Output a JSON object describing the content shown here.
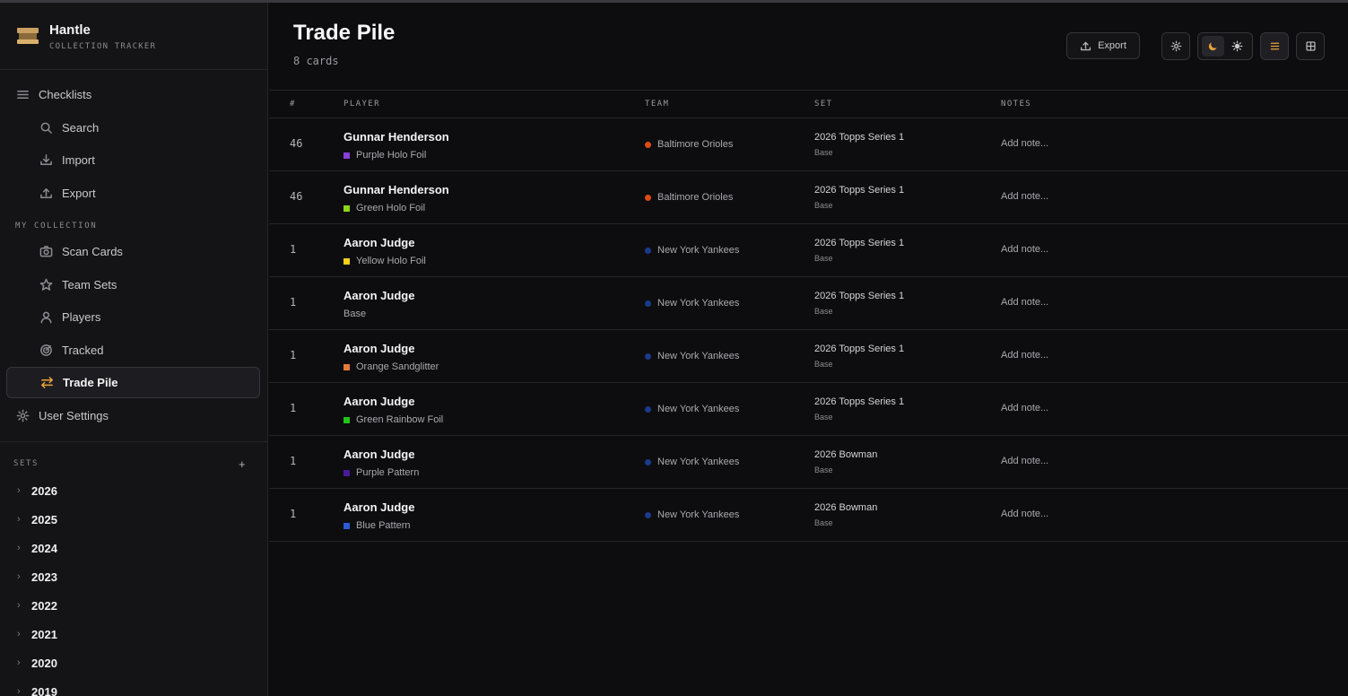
{
  "app": {
    "name": "Hantle",
    "tagline": "COLLECTION TRACKER"
  },
  "sidebar": {
    "nav_top": {
      "label": "Checklists",
      "icon": "list-icon"
    },
    "checklist_items": [
      {
        "label": "Search",
        "icon": "search-icon"
      },
      {
        "label": "Import",
        "icon": "download-icon"
      },
      {
        "label": "Export",
        "icon": "upload-icon"
      }
    ],
    "collection_label": "MY COLLECTION",
    "collection_items": [
      {
        "label": "Scan Cards",
        "icon": "camera-icon"
      },
      {
        "label": "Team Sets",
        "icon": "star-icon"
      },
      {
        "label": "Players",
        "icon": "user-icon"
      },
      {
        "label": "Tracked",
        "icon": "target-icon"
      },
      {
        "label": "Trade Pile",
        "icon": "swap-icon",
        "active": true
      }
    ],
    "settings_item": {
      "label": "User Settings",
      "icon": "gear-icon"
    },
    "sets_label": "SETS",
    "sets_add": "+",
    "years": [
      "2026",
      "2025",
      "2024",
      "2023",
      "2022",
      "2021",
      "2020",
      "2019"
    ]
  },
  "header": {
    "title": "Trade Pile",
    "subtitle": "8 cards",
    "export_label": "Export"
  },
  "table": {
    "columns": [
      "#",
      "PLAYER",
      "TEAM",
      "SET",
      "NOTES"
    ],
    "rows": [
      {
        "num": "46",
        "player": "Gunnar Henderson",
        "variant": "Purple Holo Foil",
        "variant_color": "#8a3fd6",
        "team": "Baltimore Orioles",
        "team_color": "#df4a16",
        "set": "2026 Topps Series 1",
        "set_type": "Base",
        "note": "Add note..."
      },
      {
        "num": "46",
        "player": "Gunnar Henderson",
        "variant": "Green Holo Foil",
        "variant_color": "#8cd61a",
        "team": "Baltimore Orioles",
        "team_color": "#df4a16",
        "set": "2026 Topps Series 1",
        "set_type": "Base",
        "note": "Add note..."
      },
      {
        "num": "1",
        "player": "Aaron Judge",
        "variant": "Yellow Holo Foil",
        "variant_color": "#f2d01c",
        "team": "New York Yankees",
        "team_color": "#1a3a8a",
        "set": "2026 Topps Series 1",
        "set_type": "Base",
        "note": "Add note..."
      },
      {
        "num": "1",
        "player": "Aaron Judge",
        "variant": "Base",
        "variant_color": "",
        "team": "New York Yankees",
        "team_color": "#1a3a8a",
        "set": "2026 Topps Series 1",
        "set_type": "Base",
        "note": "Add note..."
      },
      {
        "num": "1",
        "player": "Aaron Judge",
        "variant": "Orange Sandglitter",
        "variant_color": "#e87a3a",
        "team": "New York Yankees",
        "team_color": "#1a3a8a",
        "set": "2026 Topps Series 1",
        "set_type": "Base",
        "note": "Add note..."
      },
      {
        "num": "1",
        "player": "Aaron Judge",
        "variant": "Green Rainbow Foil",
        "variant_color": "#22c41a",
        "team": "New York Yankees",
        "team_color": "#1a3a8a",
        "set": "2026 Topps Series 1",
        "set_type": "Base",
        "note": "Add note..."
      },
      {
        "num": "1",
        "player": "Aaron Judge",
        "variant": "Purple Pattern",
        "variant_color": "#4a1a9a",
        "team": "New York Yankees",
        "team_color": "#1a3a8a",
        "set": "2026 Bowman",
        "set_type": "Base",
        "note": "Add note..."
      },
      {
        "num": "1",
        "player": "Aaron Judge",
        "variant": "Blue Pattern",
        "variant_color": "#2a5ad6",
        "team": "New York Yankees",
        "team_color": "#1a3a8a",
        "set": "2026 Bowman",
        "set_type": "Base",
        "note": "Add note..."
      }
    ]
  },
  "colors": {
    "accent": "#e8a23c",
    "background": "#0d0d0f",
    "sidebar": "#141416",
    "border": "#26262a"
  }
}
